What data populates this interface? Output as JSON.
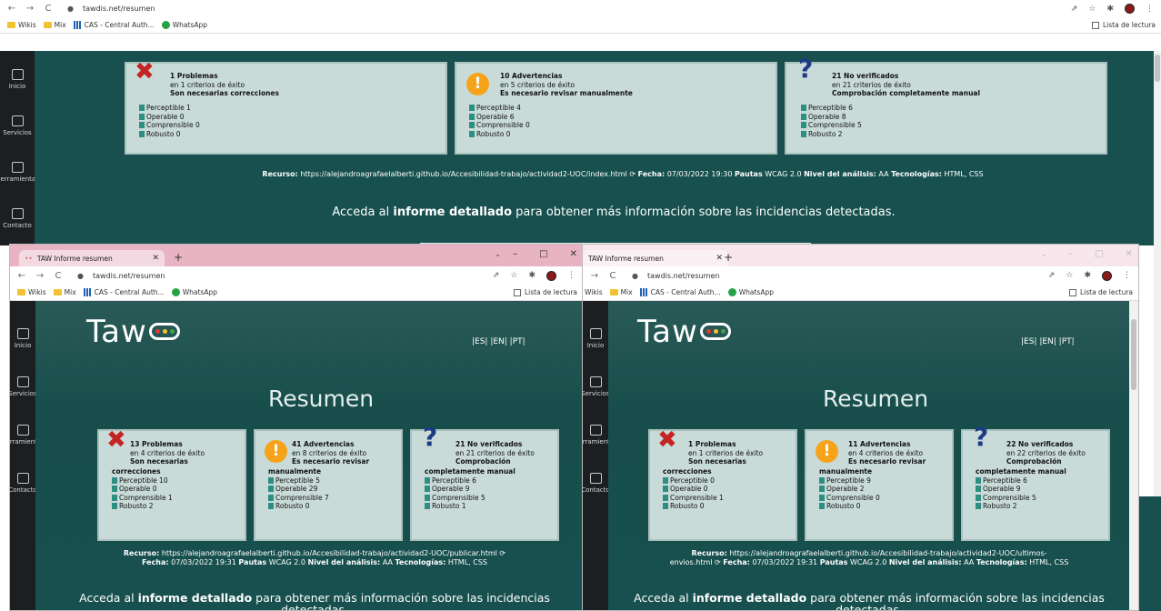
{
  "bg": {
    "url": "tawdis.net/resumen",
    "bookmarks": [
      "Wikis",
      "Mix",
      "CAS - Central Auth...",
      "WhatsApp"
    ],
    "reading_list": "Lista de lectura",
    "sidebar": [
      "Inicio",
      "Servicios",
      "Herramientas",
      "Contacto"
    ],
    "cards": [
      {
        "icon": "error",
        "title": "1 Problemas",
        "sub": "en 1 criterios de éxito",
        "note": "Son necesarias correcciones",
        "items": [
          "Perceptible 1",
          "Operable 0",
          "Comprensible 0",
          "Robusto 0"
        ]
      },
      {
        "icon": "warning",
        "title": "10 Advertencias",
        "sub": "en 5 criterios de éxito",
        "note": "Es necesario revisar manualmente",
        "items": [
          "Perceptible 4",
          "Operable 6",
          "Comprensible 0",
          "Robusto 0"
        ]
      },
      {
        "icon": "question",
        "title": "21 No verificados",
        "sub": "en 21 criterios de éxito",
        "note": "Comprobación completamente manual",
        "items": [
          "Perceptible 6",
          "Operable 8",
          "Comprensible 5",
          "Robusto 2"
        ]
      }
    ],
    "info": {
      "recurso_label": "Recurso:",
      "recurso": "https://alejandroagrafaelalberti.github.io/Accesibilidad-trabajo/actividad2-UOC/index.html",
      "fecha_label": "Fecha:",
      "fecha": "07/03/2022 19:30",
      "pautas_label": "Pautas",
      "pautas": "WCAG 2.0",
      "nivel_label": "Nivel del análisis:",
      "nivel": "AA",
      "tec_label": "Tecnologías:",
      "tec": "HTML, CSS"
    },
    "cta": {
      "pre": "Acceda al",
      "bold": "informe detallado",
      "post": "para obtener más información sobre las incidencias detectadas."
    }
  },
  "left": {
    "tab_title": "TAW Informe resumen",
    "url": "tawdis.net/resumen",
    "bookmarks": [
      "Wikis",
      "Mix",
      "CAS - Central Auth...",
      "WhatsApp"
    ],
    "reading_list": "Lista de lectura",
    "sidebar": [
      "Inicio",
      "Servicios",
      "Herramientas",
      "Contacto"
    ],
    "logo": "Taw",
    "langs": "|ES|  |EN|  |PT|",
    "heading": "Resumen",
    "cards": [
      {
        "icon": "error",
        "title": "13 Problemas",
        "sub": "en 4 criterios de éxito",
        "note1": "Son necesarias",
        "note2": "correcciones",
        "items": [
          "Perceptible 10",
          "Operable 0",
          "Comprensible 1",
          "Robusto 2"
        ]
      },
      {
        "icon": "warning",
        "title": "41 Advertencias",
        "sub": "en 8 criterios de éxito",
        "note1": "Es necesario revisar",
        "note2": "manualmente",
        "items": [
          "Perceptible 5",
          "Operable 29",
          "Comprensible 7",
          "Robusto 0"
        ]
      },
      {
        "icon": "question",
        "title": "21 No verificados",
        "sub": "en 21 criterios de éxito",
        "note1": "Comprobación",
        "note2": "completamente manual",
        "items": [
          "Perceptible 6",
          "Operable 9",
          "Comprensible 5",
          "Robusto 1"
        ]
      }
    ],
    "info": {
      "recurso_label": "Recurso:",
      "recurso": "https://alejandroagrafaelalberti.github.io/Accesibilidad-trabajo/actividad2-UOC/publicar.html",
      "fecha_label": "Fecha:",
      "fecha": "07/03/2022 19:31",
      "pautas_label": "Pautas",
      "pautas": "WCAG 2.0",
      "nivel_label": "Nivel del análisis:",
      "nivel": "AA",
      "tec_label": "Tecnologías:",
      "tec": "HTML, CSS"
    },
    "cta": {
      "pre": "Acceda al",
      "bold": "informe detallado",
      "post": "para obtener más información sobre las incidencias",
      "post2": "detectadas."
    }
  },
  "right": {
    "tab_title": "TAW Informe resumen",
    "url": "tawdis.net/resumen",
    "bookmarks": [
      "Wikis",
      "Mix",
      "CAS - Central Auth...",
      "WhatsApp"
    ],
    "reading_list": "Lista de lectura",
    "sidebar": [
      "Inicio",
      "Servicios",
      "Herramientas",
      "Contacto"
    ],
    "logo": "Taw",
    "langs": "|ES|  |EN|  |PT|",
    "heading": "Resumen",
    "cards": [
      {
        "icon": "error",
        "title": "1 Problemas",
        "sub": "en 1 criterios de éxito",
        "note1": "Son necesarias",
        "note2": "correcciones",
        "items": [
          "Perceptible 0",
          "Operable 0",
          "Comprensible 1",
          "Robusto 0"
        ]
      },
      {
        "icon": "warning",
        "title": "11 Advertencias",
        "sub": "en 4 criterios de éxito",
        "note1": "Es necesario revisar",
        "note2": "manualmente",
        "items": [
          "Perceptible 9",
          "Operable 2",
          "Comprensible 0",
          "Robusto 0"
        ]
      },
      {
        "icon": "question",
        "title": "22 No verificados",
        "sub": "en 22 criterios de éxito",
        "note1": "Comprobación",
        "note2": "completamente manual",
        "items": [
          "Perceptible 6",
          "Operable 9",
          "Comprensible 5",
          "Robusto 2"
        ]
      }
    ],
    "info": {
      "recurso_label": "Recurso:",
      "recurso": "https://alejandroagrafaelalberti.github.io/Accesibilidad-trabajo/actividad2-UOC/ultimos-",
      "recurso2": "envios.html",
      "fecha_label": "Fecha:",
      "fecha": "07/03/2022 19:31",
      "pautas_label": "Pautas",
      "pautas": "WCAG 2.0",
      "nivel_label": "Nivel del análisis:",
      "nivel": "AA",
      "tec_label": "Tecnologías:",
      "tec": "HTML, CSS"
    },
    "cta": {
      "pre": "Acceda al",
      "bold": "informe detallado",
      "post": "para obtener más información sobre las incidencias",
      "post2": "detectadas."
    }
  },
  "icons": {
    "error": "✖",
    "warning": "!",
    "question": "?",
    "back": "←",
    "forward": "→",
    "reload": "C",
    "lock": "🔒",
    "share": "⇗",
    "star": "☆",
    "puzzle": "✱",
    "menu": "⋮",
    "minimize": "–",
    "maximize": "□",
    "close": "✕",
    "newtab": "+",
    "chevron": "⌄",
    "refresh": "⟳"
  }
}
